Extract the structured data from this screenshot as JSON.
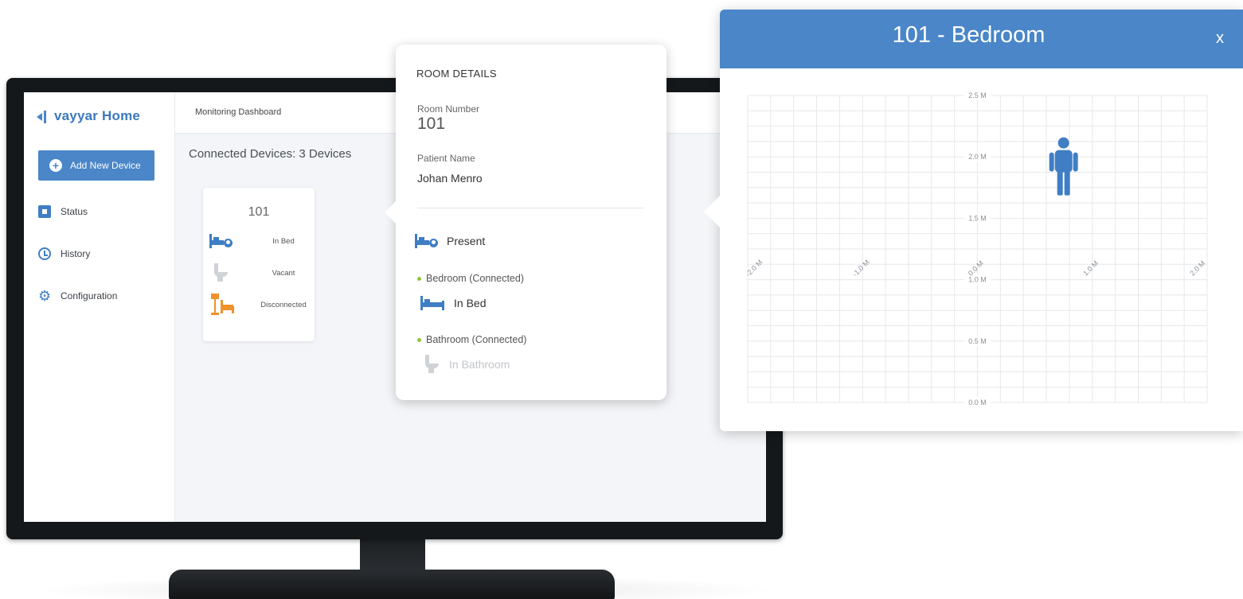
{
  "app": {
    "logo": "vayyar Home",
    "page_title": "Monitoring Dashboard",
    "add_device_label": "Add New Device",
    "nav": [
      {
        "label": "Status",
        "icon": "status-icon"
      },
      {
        "label": "History",
        "icon": "history-icon"
      },
      {
        "label": "Configuration",
        "icon": "gear-icon"
      }
    ],
    "connected_devices": "Connected Devices: 3 Devices",
    "room_card": {
      "number": "101",
      "rows": [
        {
          "label": "In Bed",
          "icon": "bed-occupied-icon"
        },
        {
          "label": "Vacant",
          "icon": "toilet-icon"
        },
        {
          "label": "Disconnected",
          "icon": "lamp-bed-icon"
        }
      ]
    }
  },
  "details": {
    "heading": "ROOM DETAILS",
    "room_number_label": "Room Number",
    "room_number": "101",
    "patient_name_label": "Patient Name",
    "patient_name": "Johan Menro",
    "presence": "Present",
    "sensors": [
      {
        "name": "Bedroom (Connected)",
        "status": "In Bed"
      },
      {
        "name": "Bathroom (Connected)",
        "status": "In Bathroom"
      }
    ],
    "colors": {
      "connected_dot": "#8dc63f",
      "accent": "#4a86c8",
      "disconnected": "#f0912c"
    }
  },
  "panel": {
    "title": "101 - Bedroom",
    "close": "x",
    "y_ticks": [
      "2.5 M",
      "2.0 M",
      "1.5 M",
      "1.0 M",
      "0.5 M",
      "0.0 M"
    ],
    "x_ticks": [
      "-2.0 M",
      "-1.0 M",
      "0.0 M",
      "1.0 M",
      "2.0 M"
    ],
    "x_range": [
      -2.0,
      2.0
    ],
    "y_range": [
      0.0,
      2.5
    ],
    "person": {
      "x": 0.75,
      "y": 1.9,
      "icon": "person-icon"
    }
  }
}
